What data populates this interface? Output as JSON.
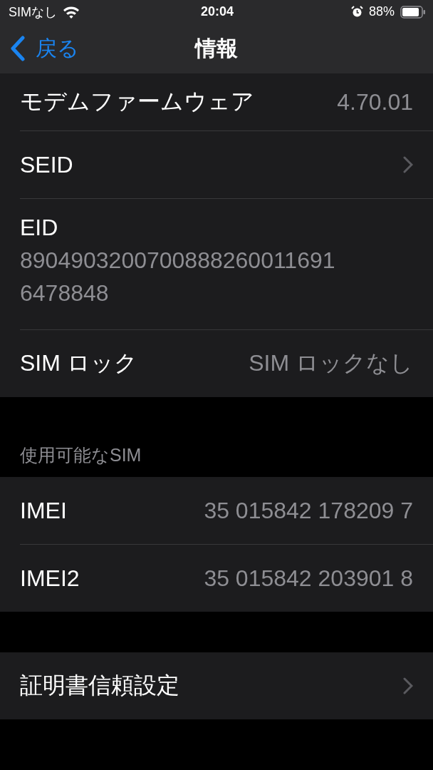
{
  "status_bar": {
    "carrier": "SIMなし",
    "time": "20:04",
    "battery": "88%"
  },
  "nav": {
    "back": "戻る",
    "title": "情報"
  },
  "sections": [
    {
      "rows": [
        {
          "kind": "value",
          "label": "モデムファームウェア",
          "value": "4.70.01"
        },
        {
          "kind": "disclosure",
          "label": "SEID"
        },
        {
          "kind": "multiline",
          "label": "EID",
          "value": "89049032007008882600116916478848"
        },
        {
          "kind": "value",
          "label": "SIM ロック",
          "value": "SIM ロックなし"
        }
      ]
    },
    {
      "header": "使用可能なSIM",
      "rows": [
        {
          "kind": "value",
          "label": "IMEI",
          "value": "35 015842 178209 7"
        },
        {
          "kind": "value",
          "label": "IMEI2",
          "value": "35 015842 203901 8"
        }
      ]
    },
    {
      "rows": [
        {
          "kind": "disclosure",
          "label": "証明書信頼設定"
        }
      ]
    }
  ]
}
